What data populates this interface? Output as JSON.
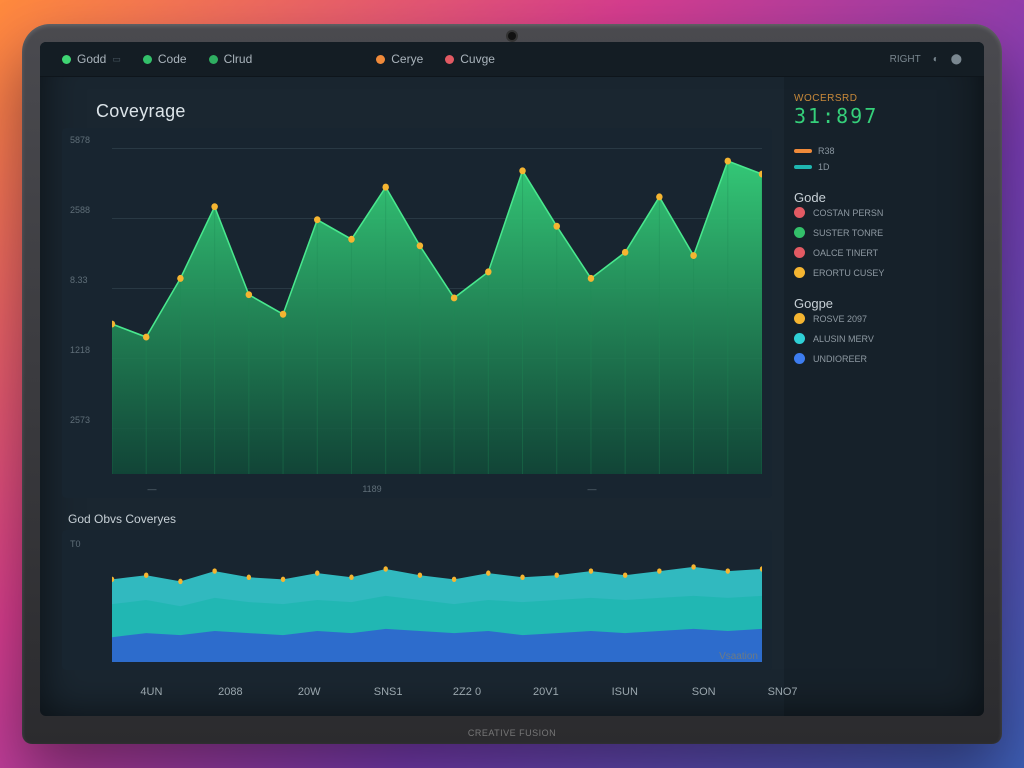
{
  "hinge_label": "CREATIVE FUSION",
  "tabs": [
    {
      "label": "Godd",
      "color": "#3fd573"
    },
    {
      "label": "Code",
      "color": "#33c06a"
    },
    {
      "label": "Clrud",
      "color": "#2fae61"
    },
    {
      "label": "Cerye",
      "color": "#f08a3a"
    },
    {
      "label": "Cuvge",
      "color": "#e25a63"
    }
  ],
  "tabs_right": {
    "label": "RIGHT",
    "icon1": "◐",
    "icon2": "⬤"
  },
  "main_chart": {
    "title": "Coveyrage",
    "yticks_text": [
      "5878",
      "2588",
      "8.33",
      "1218",
      "2573"
    ],
    "xticks_text": [
      "—",
      "1189",
      "—"
    ],
    "watermark": "",
    "chart_data": {
      "type": "area",
      "series_name": "Coverage",
      "x_index": [
        0,
        1,
        2,
        3,
        4,
        5,
        6,
        7,
        8,
        9,
        10,
        11,
        12,
        13,
        14,
        15,
        16,
        17,
        18,
        19
      ],
      "values": [
        46,
        42,
        60,
        82,
        55,
        49,
        78,
        72,
        88,
        70,
        54,
        62,
        93,
        76,
        60,
        68,
        85,
        67,
        96,
        92
      ],
      "ylim": [
        0,
        100
      ],
      "color_fill_top": "#35d07a",
      "color_fill_bottom": "#104a38",
      "point_color": "#f5b531"
    }
  },
  "sub_chart": {
    "title": "God Obvs Coveryes",
    "ylabel": "T0",
    "xticks_text": [
      "4UN",
      "2088",
      "20W",
      "SNS1",
      "2Z2 0",
      "20V1",
      "ISUN",
      "SON",
      "SNO7"
    ],
    "watermark": "Vsaation",
    "chart_data": {
      "type": "area",
      "layers": [
        {
          "name": "layer-blue",
          "color": "#2f5fd0",
          "values": [
            12,
            14,
            13,
            15,
            14,
            13,
            15,
            14,
            16,
            15,
            14,
            15,
            13,
            14,
            15,
            14,
            15,
            16,
            15,
            16
          ]
        },
        {
          "name": "layer-teal",
          "color": "#1fb6b0",
          "values": [
            28,
            30,
            27,
            31,
            29,
            28,
            30,
            29,
            32,
            30,
            28,
            30,
            29,
            30,
            31,
            30,
            31,
            32,
            31,
            32
          ]
        },
        {
          "name": "layer-cyan",
          "color": "#36d4d8",
          "values": [
            40,
            42,
            39,
            44,
            41,
            40,
            43,
            41,
            45,
            42,
            40,
            43,
            41,
            42,
            44,
            42,
            44,
            46,
            44,
            45
          ]
        }
      ],
      "ylim": [
        0,
        60
      ]
    }
  },
  "sidebar": {
    "stat_label": "WOCERSRD",
    "stat_value": "31:897",
    "mini_legend": [
      {
        "label": "R38",
        "color": "#f08a3a"
      },
      {
        "label": "1D",
        "color": "#1fb6b0"
      }
    ],
    "section1_title": "Gode",
    "legend1": [
      {
        "label": "COSTAN PERSN",
        "color": "#e25a63"
      },
      {
        "label": "SUSTER TONRE",
        "color": "#33c06a"
      },
      {
        "label": "OALCE TINERT",
        "color": "#e25a63"
      },
      {
        "label": "ERORTU CUSEY",
        "color": "#f5b531"
      }
    ],
    "section2_title": "Gogpe",
    "legend2": [
      {
        "label": "ROSVE 2097",
        "color": "#f5b531"
      },
      {
        "label": "ALUSIN MERV",
        "color": "#2fd0d6"
      },
      {
        "label": "UNDIOREER",
        "color": "#3d7df0"
      }
    ]
  },
  "rail_colors": [
    "#33c06a",
    "#e25a63",
    "#8a4adf",
    "#f08a3a"
  ],
  "chart_data": [
    {
      "ref": "main_chart.chart_data"
    },
    {
      "ref": "sub_chart.chart_data"
    }
  ]
}
